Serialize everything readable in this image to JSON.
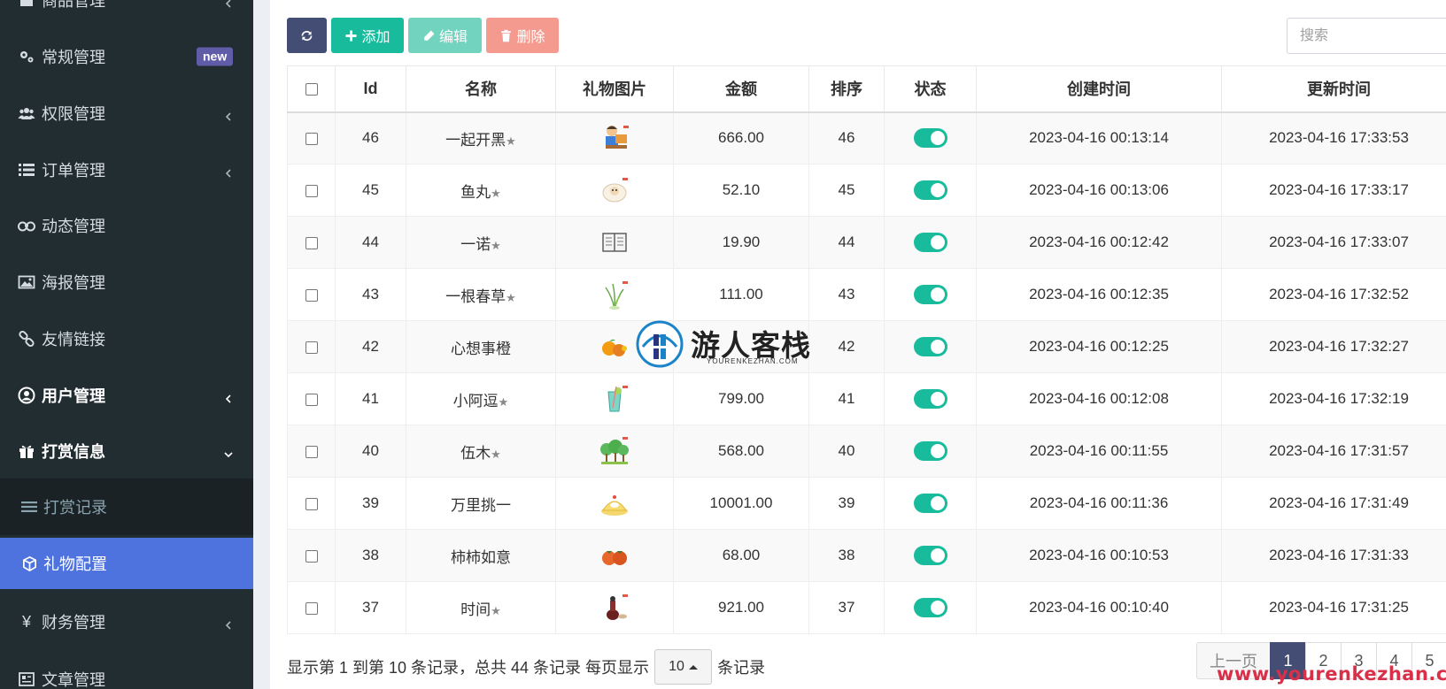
{
  "sidebar": {
    "items": [
      {
        "label": "商品管理",
        "icon": "box-icon"
      },
      {
        "label": "常规管理",
        "icon": "cogs-icon",
        "badge": "new"
      },
      {
        "label": "权限管理",
        "icon": "users-icon"
      },
      {
        "label": "订单管理",
        "icon": "list-icon"
      },
      {
        "label": "动态管理",
        "icon": "binoculars-icon"
      },
      {
        "label": "海报管理",
        "icon": "image-icon"
      },
      {
        "label": "友情链接",
        "icon": "link-icon"
      },
      {
        "label": "用户管理",
        "icon": "user-circle-icon"
      },
      {
        "label": "打赏信息",
        "icon": "gift-icon"
      },
      {
        "label": "打赏记录",
        "icon": "bars-icon"
      },
      {
        "label": "礼物配置",
        "icon": "cube-icon"
      },
      {
        "label": "财务管理",
        "icon": "yen-icon"
      },
      {
        "label": "文章管理",
        "icon": "article-icon"
      }
    ]
  },
  "toolbar": {
    "add_label": "添加",
    "edit_label": "编辑",
    "delete_label": "删除",
    "search_placeholder": "搜索"
  },
  "table": {
    "headers": [
      "Id",
      "名称",
      "礼物图片",
      "金额",
      "排序",
      "状态",
      "创建时间",
      "更新时间"
    ],
    "rows": [
      {
        "id": "46",
        "name": "一起开黑",
        "star": true,
        "price": "666.00",
        "sort": "46",
        "created": "2023-04-16 00:13:14",
        "updated": "2023-04-16 17:33:53",
        "gift": "computer"
      },
      {
        "id": "45",
        "name": "鱼丸",
        "star": true,
        "price": "52.10",
        "sort": "45",
        "created": "2023-04-16 00:13:06",
        "updated": "2023-04-16 17:33:17",
        "gift": "sheep"
      },
      {
        "id": "44",
        "name": "一诺",
        "star": true,
        "price": "19.90",
        "sort": "44",
        "created": "2023-04-16 00:12:42",
        "updated": "2023-04-16 17:33:07",
        "gift": "book"
      },
      {
        "id": "43",
        "name": "一根春草",
        "star": true,
        "price": "111.00",
        "sort": "43",
        "created": "2023-04-16 00:12:35",
        "updated": "2023-04-16 17:32:52",
        "gift": "grass"
      },
      {
        "id": "42",
        "name": "心想事橙",
        "star": false,
        "price": "",
        "sort": "42",
        "created": "2023-04-16 00:12:25",
        "updated": "2023-04-16 17:32:27",
        "gift": "orange"
      },
      {
        "id": "41",
        "name": "小阿逗",
        "star": true,
        "price": "799.00",
        "sort": "41",
        "created": "2023-04-16 00:12:08",
        "updated": "2023-04-16 17:32:19",
        "gift": "drink"
      },
      {
        "id": "40",
        "name": "伍木",
        "star": true,
        "price": "568.00",
        "sort": "40",
        "created": "2023-04-16 00:11:55",
        "updated": "2023-04-16 17:31:57",
        "gift": "trees"
      },
      {
        "id": "39",
        "name": "万里挑一",
        "star": false,
        "price": "10001.00",
        "sort": "39",
        "created": "2023-04-16 00:11:36",
        "updated": "2023-04-16 17:31:49",
        "gift": "cake"
      },
      {
        "id": "38",
        "name": "柿柿如意",
        "star": false,
        "price": "68.00",
        "sort": "38",
        "created": "2023-04-16 00:10:53",
        "updated": "2023-04-16 17:31:33",
        "gift": "persimmon"
      },
      {
        "id": "37",
        "name": "时间",
        "star": true,
        "price": "921.00",
        "sort": "37",
        "created": "2023-04-16 00:10:40",
        "updated": "2023-04-16 17:31:25",
        "gift": "hourglass"
      }
    ]
  },
  "footer": {
    "info_text": "显示第 1 到第 10 条记录，总共 44 条记录 每页显示",
    "page_size": "10",
    "suffix": "条记录",
    "prev_label": "上一页",
    "pages": [
      "1",
      "2",
      "3",
      "4",
      "5"
    ],
    "active_page": "1"
  },
  "watermark": {
    "name": "游人客栈",
    "sub": "YOURENKEZHAN.COM",
    "url": "www.yourenkezhan.com"
  },
  "colors": {
    "sidebar_bg": "#222d32",
    "active_nav": "#4e73df",
    "primary": "#444d73",
    "success": "#18bc9c",
    "danger": "#f49a8f",
    "badge": "#605ca8"
  }
}
